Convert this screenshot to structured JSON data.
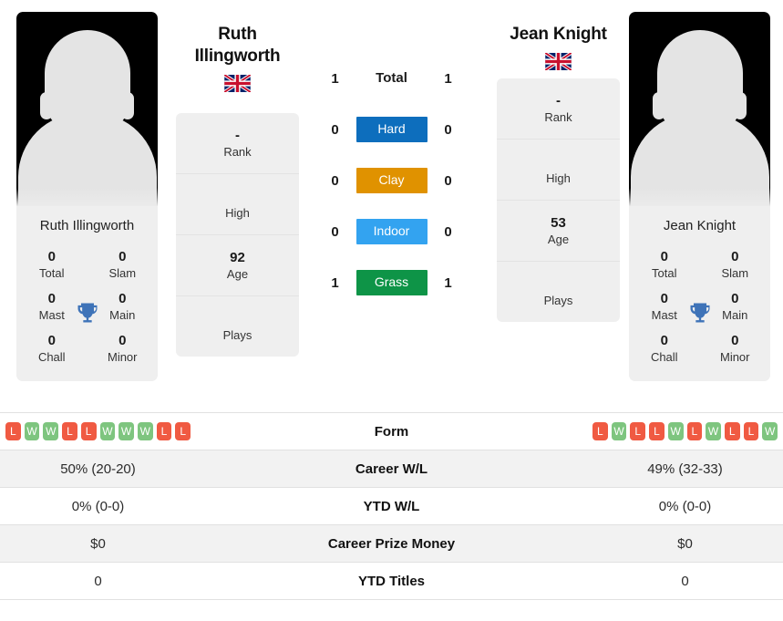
{
  "left_player": {
    "name": "Ruth Illingworth",
    "name_display": "Ruth Illingworth",
    "flag": "gb-flag-icon",
    "rank": "-",
    "rank_label": "Rank",
    "high": "",
    "high_label": "High",
    "age": "92",
    "age_label": "Age",
    "plays": "",
    "plays_label": "Plays",
    "titles": {
      "total": "0",
      "total_label": "Total",
      "slam": "0",
      "slam_label": "Slam",
      "mast": "0",
      "mast_label": "Mast",
      "main": "0",
      "main_label": "Main",
      "chall": "0",
      "chall_label": "Chall",
      "minor": "0",
      "minor_label": "Minor"
    },
    "form": [
      "L",
      "W",
      "W",
      "L",
      "L",
      "W",
      "W",
      "W",
      "L",
      "L"
    ],
    "career_wl": "50% (20-20)",
    "ytd_wl": "0% (0-0)",
    "career_prize_money": "$0",
    "ytd_titles": "0"
  },
  "right_player": {
    "name": "Jean Knight",
    "name_display": "Jean Knight",
    "flag": "gb-flag-icon",
    "rank": "-",
    "rank_label": "Rank",
    "high": "",
    "high_label": "High",
    "age": "53",
    "age_label": "Age",
    "plays": "",
    "plays_label": "Plays",
    "titles": {
      "total": "0",
      "total_label": "Total",
      "slam": "0",
      "slam_label": "Slam",
      "mast": "0",
      "mast_label": "Mast",
      "main": "0",
      "main_label": "Main",
      "chall": "0",
      "chall_label": "Chall",
      "minor": "0",
      "minor_label": "Minor"
    },
    "form": [
      "L",
      "W",
      "L",
      "L",
      "W",
      "L",
      "W",
      "L",
      "L",
      "W"
    ],
    "career_wl": "49% (32-33)",
    "ytd_wl": "0% (0-0)",
    "career_prize_money": "$0",
    "ytd_titles": "0"
  },
  "surfaces": [
    {
      "label": "Total",
      "left": "1",
      "right": "1",
      "color": "",
      "is_total": true
    },
    {
      "label": "Hard",
      "left": "0",
      "right": "0",
      "color": "#0d6ebd",
      "is_total": false
    },
    {
      "label": "Clay",
      "left": "0",
      "right": "0",
      "color": "#e09200",
      "is_total": false
    },
    {
      "label": "Indoor",
      "left": "0",
      "right": "0",
      "color": "#33a3f0",
      "is_total": false
    },
    {
      "label": "Grass",
      "left": "1",
      "right": "1",
      "color": "#0e9447",
      "is_total": false
    }
  ],
  "table_rows": [
    {
      "label": "Form",
      "key": "form",
      "type": "form",
      "stripe": false
    },
    {
      "label": "Career W/L",
      "key": "career_wl",
      "type": "text",
      "stripe": true
    },
    {
      "label": "YTD W/L",
      "key": "ytd_wl",
      "type": "text",
      "stripe": false
    },
    {
      "label": "Career Prize Money",
      "key": "career_prize_money",
      "type": "text",
      "stripe": true
    },
    {
      "label": "YTD Titles",
      "key": "ytd_titles",
      "type": "text",
      "stripe": false
    }
  ],
  "colors": {
    "hard": "#0d6ebd",
    "clay": "#e09200",
    "indoor": "#33a3f0",
    "grass": "#0e9447",
    "win": "#7ec57f",
    "loss": "#f05a42",
    "trophy": "#3e73b8",
    "panel": "#efefef"
  }
}
